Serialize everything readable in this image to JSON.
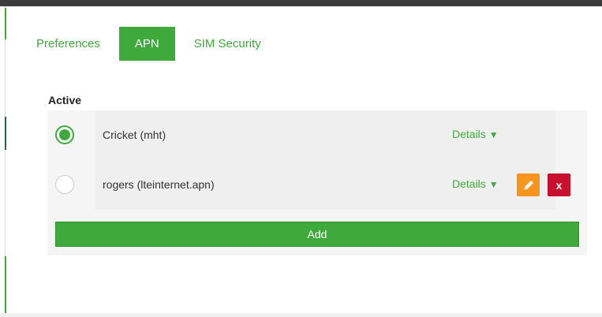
{
  "tabs": [
    {
      "label": "Preferences",
      "active": false
    },
    {
      "label": "APN",
      "active": true
    },
    {
      "label": "SIM Security",
      "active": false
    }
  ],
  "section_label": "Active",
  "apns": [
    {
      "name": "Cricket (mht)",
      "selected": true,
      "details_label": "Details",
      "details_arrow": "▼",
      "editable": false
    },
    {
      "name": "rogers (lteinternet.apn)",
      "selected": false,
      "details_label": "Details",
      "details_arrow": "▼",
      "editable": true
    }
  ],
  "delete_label": "x",
  "add_label": "Add",
  "colors": {
    "accent": "#3fa93b",
    "edit": "#f7941d",
    "delete": "#c8102e",
    "panel": "#f5f5f5"
  },
  "icons": {
    "edit": "pencil-icon",
    "delete": "close-icon",
    "details": "triangle-down-icon"
  }
}
